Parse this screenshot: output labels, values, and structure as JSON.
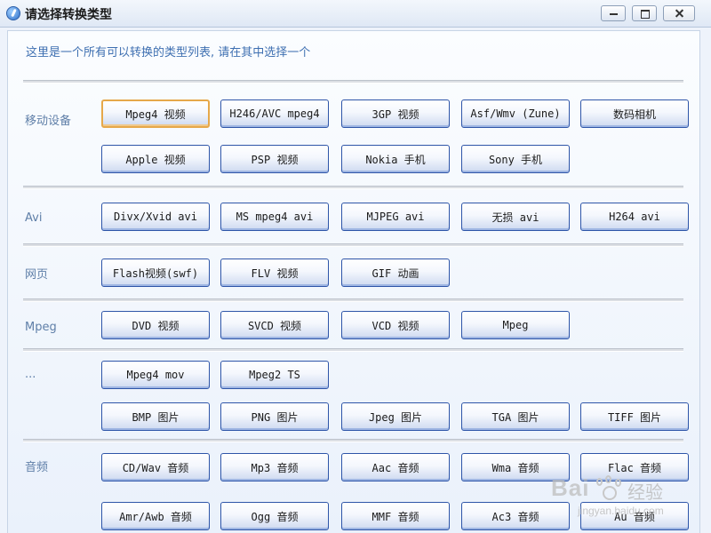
{
  "window": {
    "title": "请选择转换类型",
    "icon": "app-logo-icon",
    "controls": {
      "minimize": "minimize-icon",
      "maximize": "maximize-icon",
      "close": "close-icon"
    }
  },
  "prompt": "这里是一个所有可以转换的类型列表, 请在其中选择一个",
  "categories": {
    "mobile": "移动设备",
    "avi": "Avi",
    "web": "网页",
    "mpeg": "Mpeg",
    "more": "...",
    "audio": "音频"
  },
  "buttons": {
    "mpeg4_video": "Mpeg4 视频",
    "h246_avc": "H246/AVC mpeg4",
    "3gp_video": "3GP 视频",
    "asf_wmv": "Asf/Wmv (Zune)",
    "digital_camera": "数码相机",
    "apple_video": "Apple 视频",
    "psp_video": "PSP 视频",
    "nokia_phone": "Nokia 手机",
    "sony_phone": "Sony 手机",
    "divx_xvid": "Divx/Xvid avi",
    "ms_mpeg4": "MS mpeg4 avi",
    "mjpeg": "MJPEG avi",
    "lossless": "无损 avi",
    "h264_avi": "H264 avi",
    "flash_video": "Flash视频(swf)",
    "flv_video": "FLV 视频",
    "gif_anim": "GIF 动画",
    "dvd_video": "DVD 视频",
    "svcd_video": "SVCD 视频",
    "vcd_video": "VCD 视频",
    "mpeg": "Mpeg",
    "mpeg4_mov": "Mpeg4 mov",
    "mpeg2_ts": "Mpeg2 TS",
    "bmp": "BMP 图片",
    "png": "PNG 图片",
    "jpeg": "Jpeg 图片",
    "tga": "TGA 图片",
    "tiff": "TIFF 图片",
    "cd_wav": "CD/Wav 音频",
    "mp3": "Mp3 音频",
    "aac": "Aac 音频",
    "wma": "Wma 音频",
    "flac": "Flac 音频",
    "amr_awb": "Amr/Awb 音频",
    "ogg": "Ogg 音频",
    "mmf": "MMF 音频",
    "ac3": "Ac3 音频",
    "au": "Au 音频"
  },
  "focused_button": "mpeg4_video",
  "watermark": {
    "brand": "Bai",
    "cn": "经验",
    "url": "jingyan.baidu.com",
    "icon": "baidu-paw-icon"
  }
}
